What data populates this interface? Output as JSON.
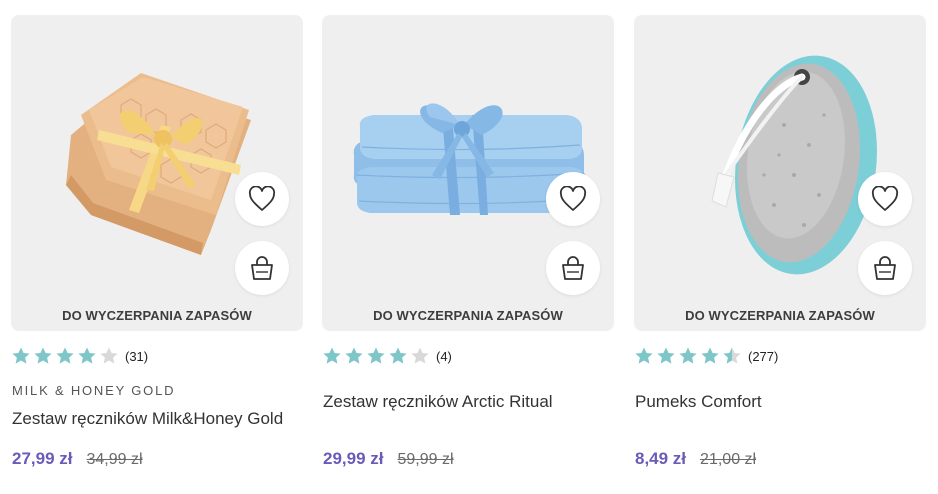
{
  "colors": {
    "star_filled": "#7fc6c9",
    "star_empty": "#d9d9d9",
    "price_accent": "#6b5bb8",
    "image_bg": "#efefef"
  },
  "icons": {
    "favorite": "heart-icon",
    "cart": "shopping-bag-icon",
    "rating": "star-icon"
  },
  "products": [
    {
      "badge": "DO WYCZERPANIA ZAPASÓW",
      "rating": 4,
      "rating_count": "(31)",
      "brand": "MILK & HONEY GOLD",
      "name": "Zestaw ręczników Milk&Honey Gold",
      "price": "27,99 zł",
      "old_price": "34,99 zł"
    },
    {
      "badge": "DO WYCZERPANIA ZAPASÓW",
      "rating": 4,
      "rating_count": "(4)",
      "brand": "",
      "name": "Zestaw ręczników Arctic Ritual",
      "price": "29,99 zł",
      "old_price": "59,99 zł"
    },
    {
      "badge": "DO WYCZERPANIA ZAPASÓW",
      "rating": 4.5,
      "rating_count": "(277)",
      "brand": "",
      "name": "Pumeks Comfort",
      "price": "8,49 zł",
      "old_price": "21,00 zł"
    }
  ]
}
